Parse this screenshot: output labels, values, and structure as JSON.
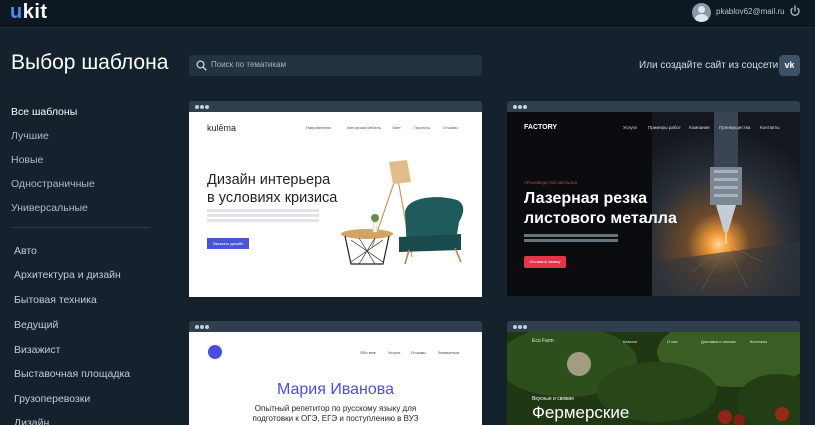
{
  "app": {
    "logo_u": "u",
    "logo_rest": "kit"
  },
  "header": {
    "email": "pkablov62@mail.ru"
  },
  "page": {
    "title": "Выбор шаблона",
    "search_placeholder": "Поиск по тематикам",
    "social_text": "Или создайте сайт из соцсети",
    "vk_label": "vk"
  },
  "sidebar": {
    "filters": [
      {
        "label": "Все шаблоны",
        "active": true
      },
      {
        "label": "Лучшие",
        "active": false
      },
      {
        "label": "Новые",
        "active": false
      },
      {
        "label": "Одностраничные",
        "active": false
      },
      {
        "label": "Универсальные",
        "active": false
      }
    ],
    "categories": [
      "Авто",
      "Архитектура и дизайн",
      "Бытовая техника",
      "Ведущий",
      "Визажист",
      "Выставочная площадка",
      "Грузоперевозки",
      "Дизайн"
    ]
  },
  "templates": [
    {
      "brand": "kulēma",
      "menu": [
        "Направления",
        "Авторская мебель",
        "Свет",
        "Проекты",
        "Отзывы"
      ],
      "headline_1": "Дизайн интерьера",
      "headline_2": "в условиях кризиса",
      "cta": "Заказать дизайн"
    },
    {
      "brand": "FACTORY",
      "menu": [
        "Услуги",
        "Примеры работ",
        "Компания",
        "Преимущества",
        "Контакты"
      ],
      "tag": "ПРОИЗВОДСТВО МЕТАЛЛА",
      "headline_1": "Лазерная резка",
      "headline_2": "листового металла",
      "cta": "Оставить заявку"
    },
    {
      "menu": [
        "Обо мне",
        "Услуги",
        "Отзывы",
        "Записаться"
      ],
      "headline": "Мария Иванова",
      "sub_1": "Опытный репетитор по русскому языку для",
      "sub_2": "подготовки к ОГЭ, ЕГЭ и поступлению в ВУЗ"
    },
    {
      "brand": "Eco Farm",
      "menu": [
        "Каталог",
        "О нас",
        "Доставка и оплата",
        "Контакты"
      ],
      "sub": "Вкусные и свежие",
      "headline": "Фермерские"
    }
  ],
  "colors": {
    "bg": "#15212c",
    "topbar": "#0e1822",
    "accent": "#4a8cf0",
    "cta_red": "#e8344a",
    "cta_blue": "#4a55d6"
  }
}
